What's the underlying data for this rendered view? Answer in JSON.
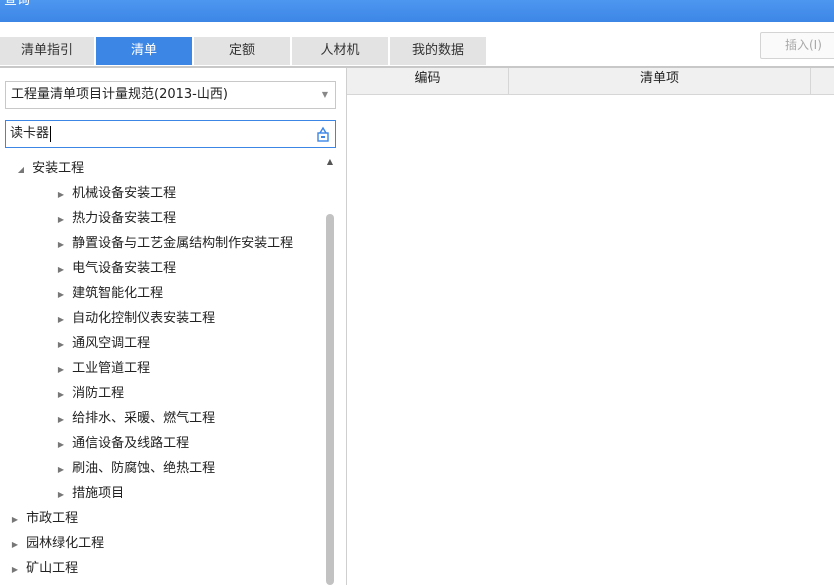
{
  "window": {
    "title": "查询"
  },
  "tabs": [
    {
      "label": "清单指引",
      "active": false
    },
    {
      "label": "清单",
      "active": true
    },
    {
      "label": "定额",
      "active": false
    },
    {
      "label": "人材机",
      "active": false
    },
    {
      "label": "我的数据",
      "active": false
    }
  ],
  "toolbar": {
    "insert_label": "插入(I)"
  },
  "left": {
    "spec_select": {
      "value": "工程量清单项目计量规范(2013-山西)"
    },
    "search": {
      "value": "读卡器"
    },
    "tree": [
      {
        "label": "安装工程",
        "expanded": true,
        "level": 0
      },
      {
        "label": "机械设备安装工程",
        "level": 1
      },
      {
        "label": "热力设备安装工程",
        "level": 1
      },
      {
        "label": "静置设备与工艺金属结构制作安装工程",
        "level": 1
      },
      {
        "label": "电气设备安装工程",
        "level": 1
      },
      {
        "label": "建筑智能化工程",
        "level": 1
      },
      {
        "label": "自动化控制仪表安装工程",
        "level": 1
      },
      {
        "label": "通风空调工程",
        "level": 1
      },
      {
        "label": "工业管道工程",
        "level": 1
      },
      {
        "label": "消防工程",
        "level": 1
      },
      {
        "label": "给排水、采暖、燃气工程",
        "level": 1
      },
      {
        "label": "通信设备及线路工程",
        "level": 1
      },
      {
        "label": "刷油、防腐蚀、绝热工程",
        "level": 1
      },
      {
        "label": "措施项目",
        "level": 1
      },
      {
        "label": "市政工程",
        "level": 0
      },
      {
        "label": "园林绿化工程",
        "level": 0
      },
      {
        "label": "矿山工程",
        "level": 0
      }
    ]
  },
  "grid": {
    "columns": [
      "编码",
      "清单项"
    ]
  },
  "colors": {
    "accent": "#3c86e6",
    "tab_inactive": "#e3e3e3"
  }
}
